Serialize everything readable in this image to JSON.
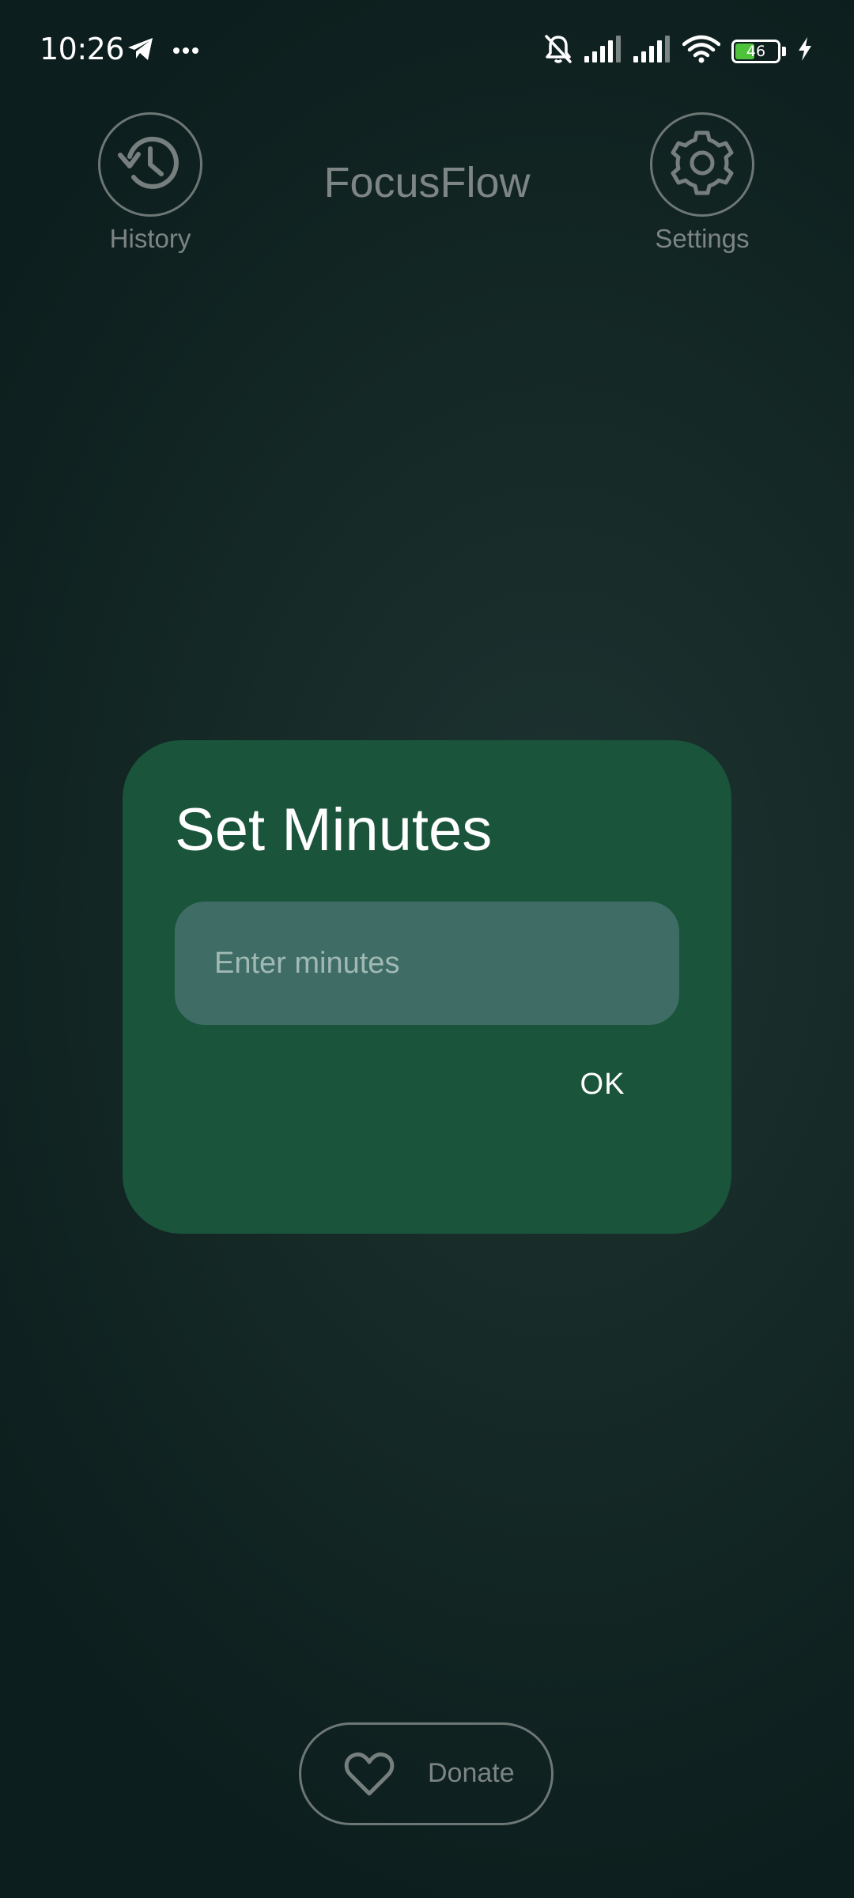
{
  "status_bar": {
    "time": "10:26",
    "battery_level": "46",
    "battery_fraction": 0.46,
    "icons": [
      "telegram-icon",
      "more-dots-icon",
      "bell-muted-icon",
      "signal-icon",
      "signal-icon",
      "wifi-icon",
      "battery-icon",
      "charging-icon"
    ]
  },
  "header": {
    "title": "FocusFlow",
    "history_label": "History",
    "history_icon": "history-clock-icon",
    "settings_label": "Settings",
    "settings_icon": "gear-icon"
  },
  "dialog": {
    "title": "Set Minutes",
    "input_value": "",
    "input_placeholder": "Enter minutes",
    "ok_label": "OK"
  },
  "donate": {
    "label": "Donate",
    "icon": "heart-icon"
  },
  "colors": {
    "dialog_background": "#1a543b",
    "input_background": "#3f6d66",
    "muted_text": "#7c8583",
    "battery_fill": "#4ec23a"
  }
}
